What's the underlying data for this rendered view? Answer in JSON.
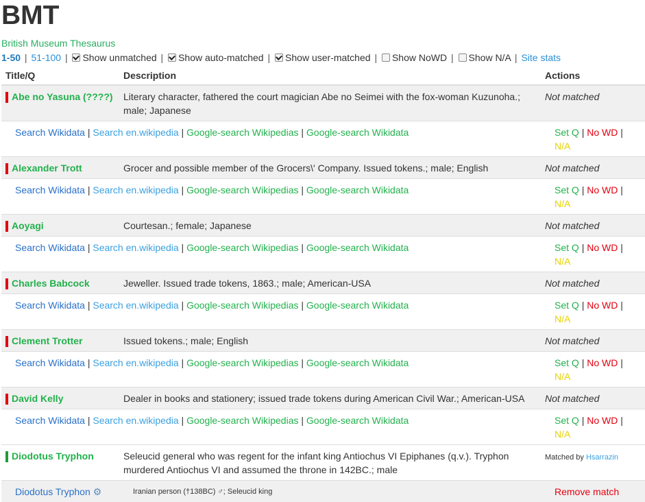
{
  "header": {
    "title": "BMT",
    "subtitle": "British Museum Thesaurus"
  },
  "filters": {
    "page_current": "1-50",
    "page_next": "51-100",
    "show_unmatched": "Show unmatched",
    "show_auto": "Show auto-matched",
    "show_user": "Show user-matched",
    "show_nowd": "Show NoWD",
    "show_na": "Show N/A",
    "site_stats": "Site stats"
  },
  "table": {
    "headers": {
      "title": "Title/Q",
      "description": "Description",
      "actions": "Actions"
    }
  },
  "links": {
    "search_wd": "Search Wikidata",
    "search_enwp": "Search en.wikipedia",
    "google_wp": "Google-search Wikipedias",
    "google_wd": "Google-search Wikidata",
    "sep": "|",
    "set_q": "Set Q",
    "no_wd": "No WD",
    "na": "N/A",
    "not_matched": "Not matched"
  },
  "rows": [
    {
      "name": "Abe no Yasuna (????)",
      "desc": "Literary character, fathered the court magician Abe no Seimei with the fox-woman Kuzunoha.; male; Japanese"
    },
    {
      "name": "Alexander Trott",
      "desc": "Grocer and possible member of the Grocers\\' Company. Issued tokens.; male; English"
    },
    {
      "name": "Aoyagi",
      "desc": "Courtesan.; female; Japanese"
    },
    {
      "name": "Charles Babcock",
      "desc": "Jeweller. Issued trade tokens, 1863.; male; American-USA"
    },
    {
      "name": "Clement Trotter",
      "desc": "Issued tokens.; male; English"
    },
    {
      "name": "David Kelly",
      "desc": "Dealer in books and stationery; issued trade tokens during American Civil War.; American-USA"
    }
  ],
  "matched_row": {
    "name": "Diodotus Tryphon",
    "desc": "Seleucid general who was regent for the infant king Antiochus VI Epiphanes (q.v.). Tryphon murdered Antiochus VI and assumed the throne in 142BC.; male",
    "matched_by_label": "Matched by",
    "matched_by_user": "Hsarrazin",
    "wd_label": "Diodotus Tryphon",
    "wd_desc": "Iranian person (†138BC) ♂; Seleucid king",
    "remove": "Remove match",
    "gear_icon": "gear-icon"
  },
  "colors": {
    "unmatched_bar": "#e3000f",
    "matched_bar": "#229a3b",
    "name_green": "#22b14c"
  }
}
